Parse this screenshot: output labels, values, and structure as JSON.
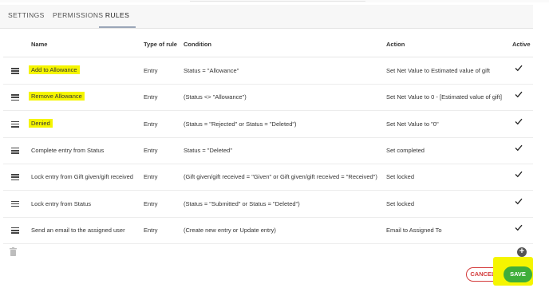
{
  "tabs": [
    {
      "label": "SETTINGS",
      "active": false
    },
    {
      "label": "PERMISSIONS",
      "active": false
    },
    {
      "label": "RULES",
      "active": true
    }
  ],
  "table": {
    "headers": {
      "name": "Name",
      "type": "Type of rule",
      "condition": "Condition",
      "action": "Action",
      "active": "Active"
    },
    "rows": [
      {
        "name": "Add to Allowance",
        "highlighted": true,
        "type": "Entry",
        "condition": "Status = \"Allowance\"",
        "action": "Set Net Value to Estimated value of gift",
        "active": true
      },
      {
        "name": "Remove Allowance",
        "highlighted": true,
        "type": "Entry",
        "condition": "(Status <> \"Allowance\")",
        "action": "Set Net Value to 0 - [Estimated value of gift]",
        "active": true
      },
      {
        "name": "Denied",
        "highlighted": true,
        "type": "Entry",
        "condition": "(Status = \"Rejected\" or Status = \"Deleted\")",
        "action": "Set Net Value to \"0\"",
        "active": true
      },
      {
        "name": "Complete entry from Status",
        "highlighted": false,
        "type": "Entry",
        "condition": "Status = \"Deleted\"",
        "action": "Set completed",
        "active": true
      },
      {
        "name": "Lock entry from Gift given/gift received",
        "highlighted": false,
        "type": "Entry",
        "condition": "(Gift given/gift received = \"Given\" or Gift given/gift received = \"Received\")",
        "action": "Set locked",
        "active": true
      },
      {
        "name": "Lock entry from Status",
        "highlighted": false,
        "type": "Entry",
        "condition": "(Status = \"Submitted\" or Status = \"Deleted\")",
        "action": "Set locked",
        "active": true
      },
      {
        "name": "Send an email to the assigned user",
        "highlighted": false,
        "type": "Entry",
        "condition": "(Create new entry or Update entry)",
        "action": "Email to Assigned To",
        "active": true
      }
    ]
  },
  "icons": {
    "drag": "drag-handle-icon",
    "active": "checkmark-icon",
    "delete": "trash-icon",
    "add": "add-circle-icon"
  },
  "buttons": {
    "cancel": "CANCEL",
    "save": "SAVE"
  },
  "colors": {
    "highlight": "#f5f500",
    "save": "#3fae3a",
    "cancel": "#d43c3c"
  }
}
